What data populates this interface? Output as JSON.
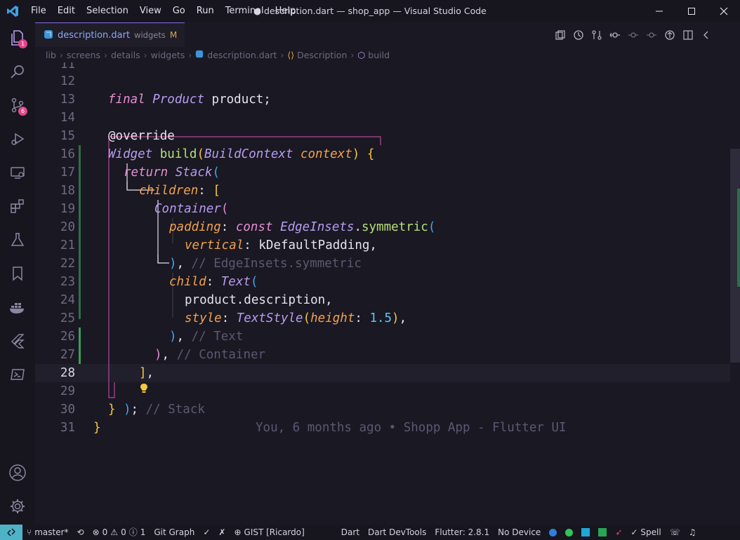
{
  "window": {
    "title": "● description.dart — shop_app — Visual Studio Code",
    "menu": [
      "File",
      "Edit",
      "Selection",
      "View",
      "Go",
      "Run",
      "Terminal",
      "Help"
    ]
  },
  "activity_bar": {
    "explorer_badge": "1",
    "source_control_badge": "6"
  },
  "tab": {
    "filename": "description.dart",
    "folder": "widgets",
    "status": "M"
  },
  "breadcrumb": [
    "lib",
    "screens",
    "details",
    "widgets",
    "description.dart",
    "Description",
    "build"
  ],
  "editor": {
    "line_numbers": [
      "11",
      "12",
      "13",
      "14",
      "15",
      "16",
      "17",
      "18",
      "19",
      "20",
      "21",
      "22",
      "23",
      "24",
      "25",
      "26",
      "27",
      "28",
      "29",
      "30",
      "31"
    ],
    "active_line": "28",
    "blame": "You, 6 months ago • Shopp App - Flutter UI",
    "code": {
      "l12_final": "final",
      "l12_type": "Product",
      "l12_rest": "product;",
      "l14": "@override",
      "l15_type": "Widget",
      "l15_fn": "build",
      "l15_ptype": "BuildContext",
      "l15_param": "context",
      "l16_kw": "return",
      "l16_type": "Stack",
      "l17_param": "children",
      "l18_type": "Container",
      "l19_param": "padding",
      "l19_kw": "const",
      "l19_type": "EdgeInsets",
      "l19_fn": "symmetric",
      "l20_param": "vertical",
      "l20_val": "kDefaultPadding,",
      "l21_comment": "// EdgeInsets.symmetric",
      "l22_param": "child",
      "l22_type": "Text",
      "l23": "product.description,",
      "l24_param": "style",
      "l24_type": "TextStyle",
      "l24_param2": "height",
      "l24_num": "1.5",
      "l25_comment": "// Text",
      "l26_comment": "// Container",
      "l28_comment": "// Stack"
    }
  },
  "status_bar": {
    "branch": "master*",
    "errors": "0",
    "warnings": "0",
    "info": "1",
    "git_graph": "Git Graph",
    "gist": "GIST [Ricardo]",
    "language": "Dart",
    "devtools": "Dart DevTools",
    "flutter": "Flutter: 2.8.1",
    "device": "No Device",
    "spell": "Spell"
  },
  "colors": {
    "accent": "#8a6ee8",
    "background": "#1a1822",
    "status_remote": "#4fb3c7"
  }
}
